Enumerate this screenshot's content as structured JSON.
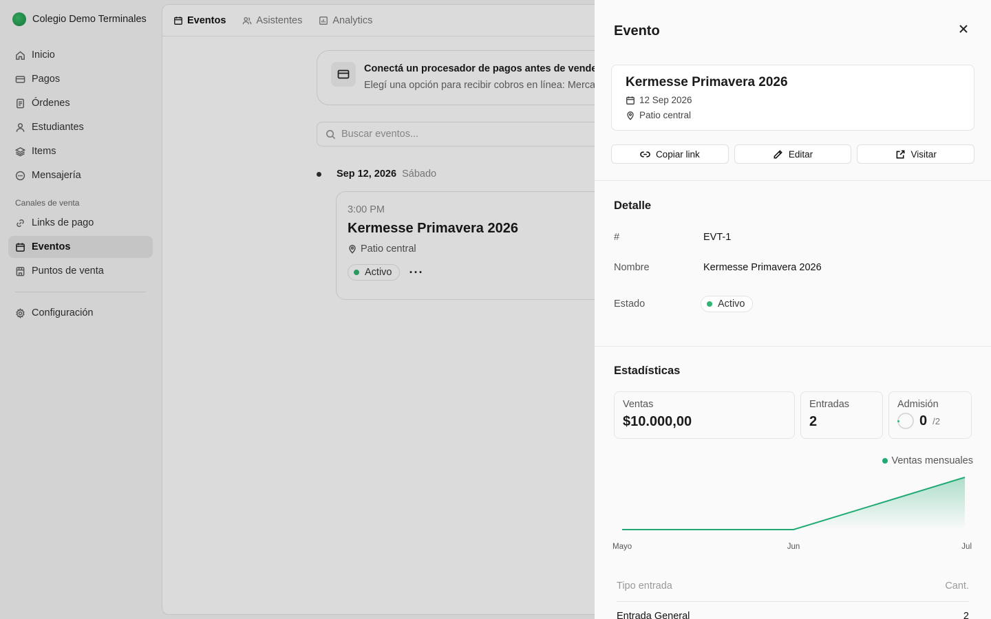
{
  "sidebar": {
    "brand": "Colegio Demo Terminales",
    "items": [
      {
        "label": "Inicio",
        "icon": "home-icon"
      },
      {
        "label": "Pagos",
        "icon": "credit-card-icon"
      },
      {
        "label": "Órdenes",
        "icon": "receipt-icon"
      },
      {
        "label": "Estudiantes",
        "icon": "user-icon"
      },
      {
        "label": "Items",
        "icon": "layers-icon"
      },
      {
        "label": "Mensajería",
        "icon": "message-icon"
      }
    ],
    "section_label": "Canales de venta",
    "channels": [
      {
        "label": "Links de pago",
        "icon": "link-icon"
      },
      {
        "label": "Eventos",
        "icon": "calendar-icon",
        "active": true
      },
      {
        "label": "Puntos de venta",
        "icon": "store-icon"
      }
    ],
    "settings_label": "Configuración"
  },
  "tabs": [
    {
      "label": "Eventos",
      "active": true
    },
    {
      "label": "Asistentes"
    },
    {
      "label": "Analytics"
    }
  ],
  "banner": {
    "title": "Conectá un procesador de pagos antes de vender",
    "text": "Elegí una opción para recibir cobros en línea: Mercado"
  },
  "search": {
    "placeholder": "Buscar eventos..."
  },
  "timeline": {
    "date": "Sep 12, 2026",
    "weekday": "Sábado"
  },
  "event_card": {
    "time": "3:00 PM",
    "title": "Kermesse Primavera 2026",
    "location": "Patio central",
    "status": "Activo",
    "more": "···"
  },
  "drawer": {
    "title": "Evento",
    "summary": {
      "title": "Kermesse Primavera 2026",
      "date": "12 Sep 2026",
      "location": "Patio central"
    },
    "actions": {
      "copy": "Copiar link",
      "edit": "Editar",
      "visit": "Visitar"
    },
    "detail": {
      "title": "Detalle",
      "id_label": "#",
      "id_value": "EVT-1",
      "name_label": "Nombre",
      "name_value": "Kermesse Primavera 2026",
      "status_label": "Estado",
      "status_value": "Activo"
    },
    "stats": {
      "title": "Estadísticas",
      "sales_label": "Ventas",
      "sales_value": "$10.000,00",
      "tickets_label": "Entradas",
      "tickets_value": "2",
      "admission_label": "Admisión",
      "admission_value": "0",
      "admission_total": "/2"
    },
    "ticket_table": {
      "col_type": "Tipo entrada",
      "col_qty": "Cant.",
      "rows": [
        {
          "type": "Entrada General",
          "qty": "2"
        }
      ]
    }
  },
  "chart_data": {
    "type": "area",
    "categories": [
      "Mayo",
      "Jun",
      "Jul"
    ],
    "series": [
      {
        "name": "Ventas mensuales",
        "values": [
          0,
          0,
          10000
        ]
      }
    ],
    "color": "#1eaa72"
  },
  "colors": {
    "accent": "#1eaa72",
    "active_dot": "#2fb574"
  }
}
